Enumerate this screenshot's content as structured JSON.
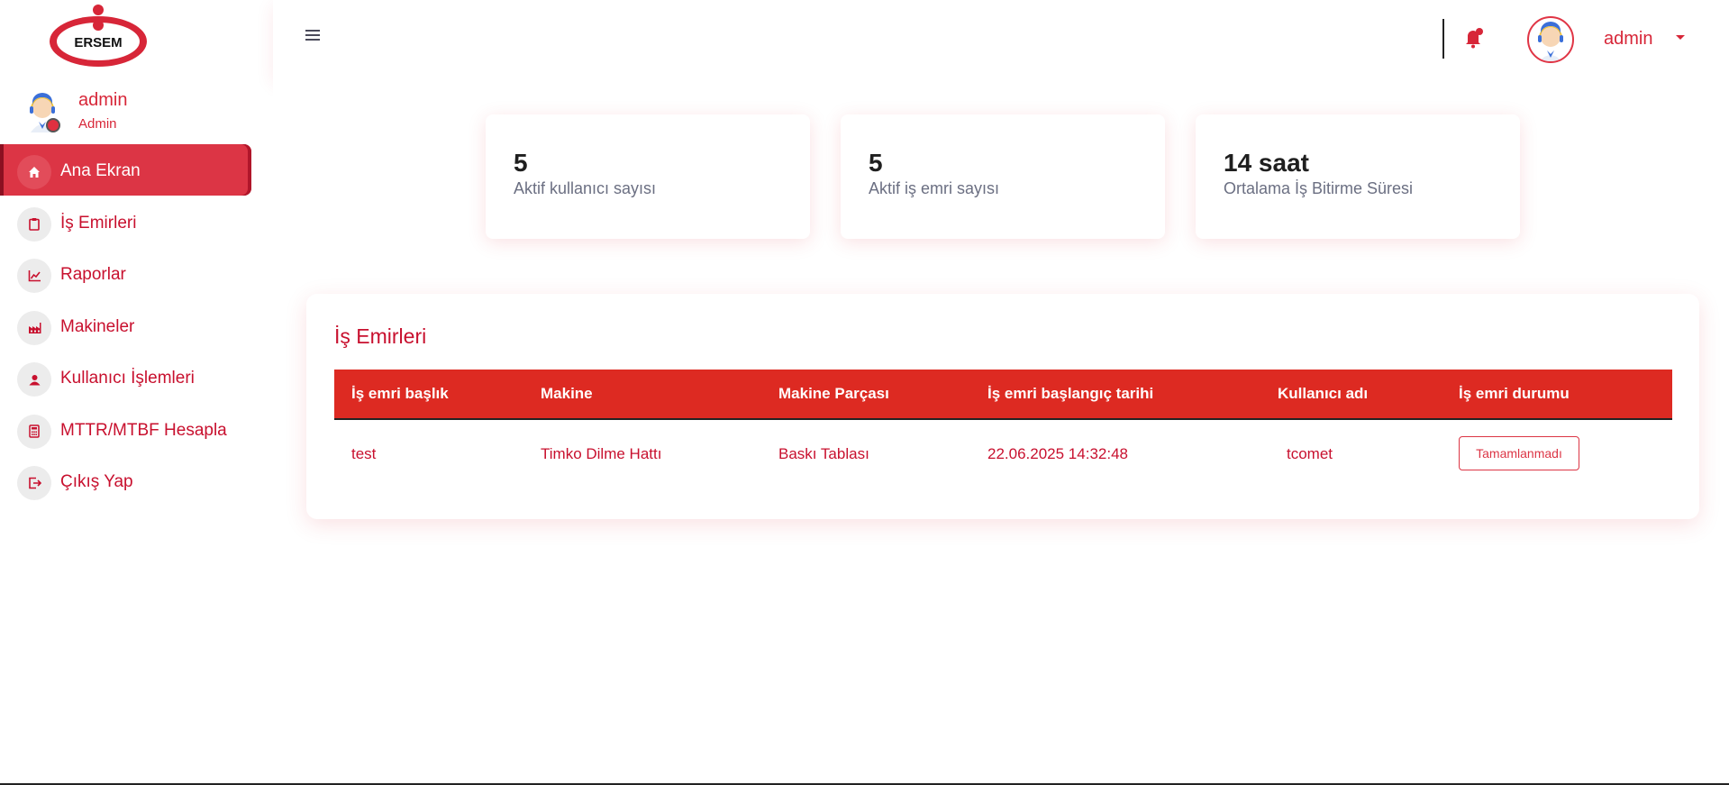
{
  "brand": {
    "logo_text": "ERSEM",
    "color": "#c8102e"
  },
  "profile": {
    "name": "admin",
    "role": "Admin"
  },
  "nav": {
    "items": [
      {
        "label": "Ana Ekran",
        "icon": "home-icon",
        "active": true
      },
      {
        "label": "İş Emirleri",
        "icon": "clipboard-icon"
      },
      {
        "label": "Raporlar",
        "icon": "chart-line-icon"
      },
      {
        "label": "Makineler",
        "icon": "factory-icon"
      },
      {
        "label": "Kullanıcı İşlemleri",
        "icon": "user-icon"
      },
      {
        "label": "MTTR/MTBF Hesapla",
        "icon": "calculator-icon"
      },
      {
        "label": "Çıkış Yap",
        "icon": "logout-icon"
      }
    ]
  },
  "topbar": {
    "username": "admin",
    "icons": [
      "menu-icon",
      "bell-icon",
      "avatar",
      "caret-down-icon"
    ]
  },
  "stats": [
    {
      "value": "5",
      "label": "Aktif kullanıcı sayısı"
    },
    {
      "value": "5",
      "label": "Aktif iş emri sayısı"
    },
    {
      "value": "14 saat",
      "label": "Ortalama İş Bitirme Süresi"
    }
  ],
  "work_orders": {
    "title": "İş Emirleri",
    "columns": [
      "İş emri başlık",
      "Makine",
      "Makine Parçası",
      "İş emri başlangıç tarihi",
      "Kullanıcı adı",
      "İş emri durumu"
    ],
    "rows": [
      {
        "title": "test",
        "machine": "Timko Dilme Hattı",
        "part": "Baskı Tablası",
        "start_date": "22.06.2025 14:32:48",
        "user": "tcomet",
        "status": "Tamamlanmadı"
      }
    ]
  },
  "colors": {
    "primary": "#dc3545",
    "header_red": "#dd2a22",
    "text_red": "#c8102e"
  }
}
